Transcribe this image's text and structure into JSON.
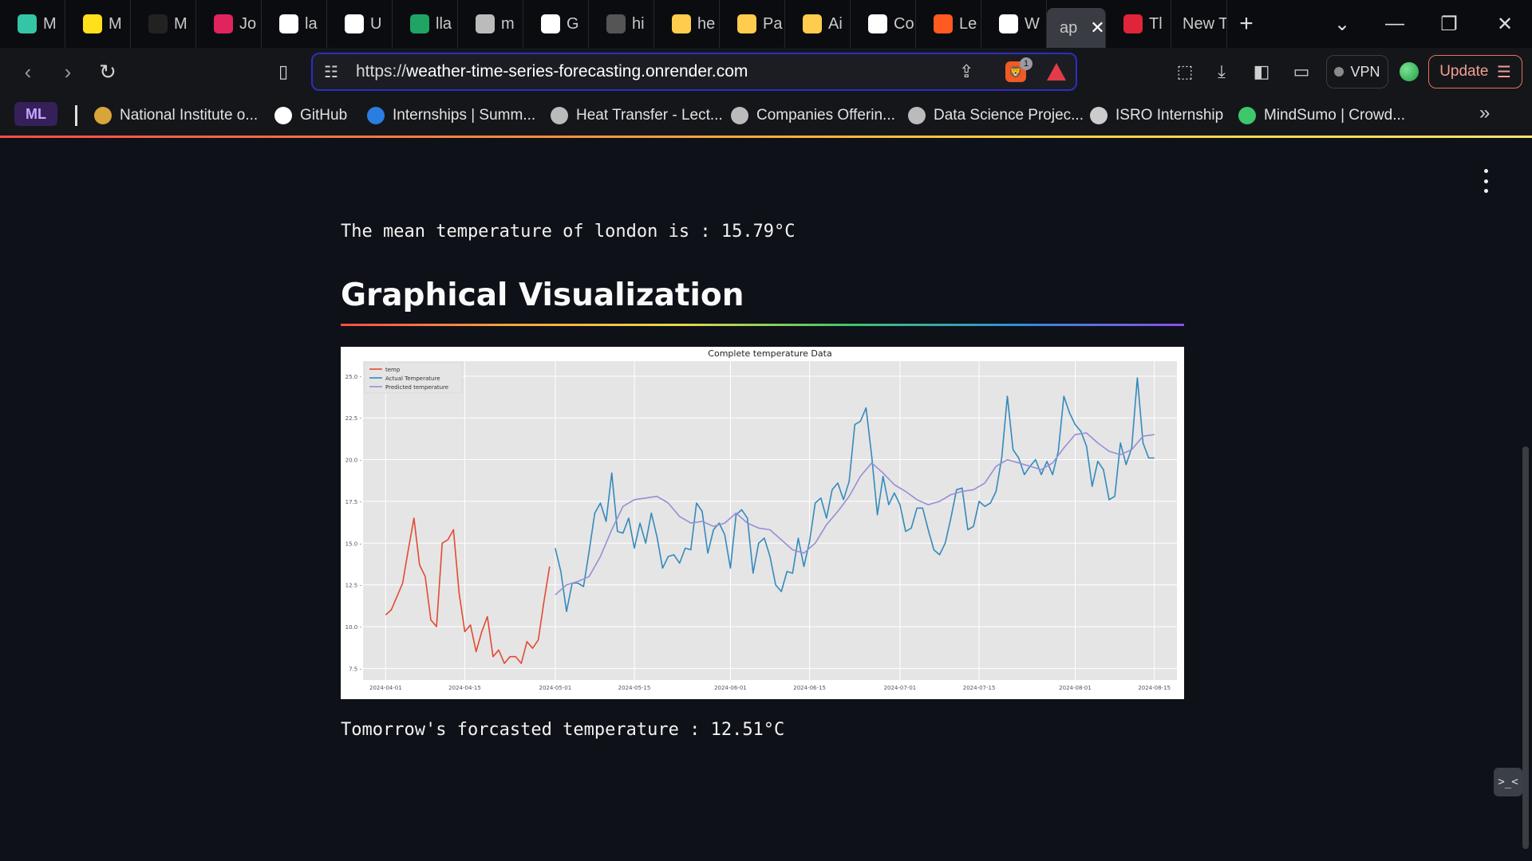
{
  "tabs": [
    {
      "label": "M",
      "icon": "wave-icon",
      "color": "#34c5a6"
    },
    {
      "label": "M",
      "icon": "mailchimp-icon",
      "color": "#ffe01b"
    },
    {
      "label": "M",
      "icon": "puzzle-icon",
      "color": "#222222"
    },
    {
      "label": "Jo",
      "icon": "s-logo-icon",
      "color": "#e0245e"
    },
    {
      "label": "la",
      "icon": "github-icon",
      "color": "#ffffff"
    },
    {
      "label": "U",
      "icon": "github-icon",
      "color": "#ffffff"
    },
    {
      "label": "lla",
      "icon": "drive-icon",
      "color": "#1fa463"
    },
    {
      "label": "m",
      "icon": "globe-icon",
      "color": "#bbbbbb"
    },
    {
      "label": "G",
      "icon": "openai-icon",
      "color": "#ffffff"
    },
    {
      "label": "hi",
      "icon": "github-icon",
      "color": "#555555"
    },
    {
      "label": "he",
      "icon": "huggingface-icon",
      "color": "#ffcc4d"
    },
    {
      "label": "Pa",
      "icon": "huggingface-icon",
      "color": "#ffcc4d"
    },
    {
      "label": "Ai",
      "icon": "huggingface-icon",
      "color": "#ffcc4d"
    },
    {
      "label": "Co",
      "icon": "d-logo-icon",
      "color": "#ffffff"
    },
    {
      "label": "Le",
      "icon": "orange-square-icon",
      "color": "#ff5a1f"
    },
    {
      "label": "W",
      "icon": "wrench-icon",
      "color": "#ffffff"
    },
    {
      "label": "ap",
      "icon": "",
      "color": "",
      "active": true
    },
    {
      "label": "Tl",
      "icon": "crown-icon",
      "color": "#e0243a"
    },
    {
      "label": "New T",
      "icon": "",
      "color": ""
    }
  ],
  "browser": {
    "url_prefix": "https://",
    "url_domain": "weather-time-series-forecasting.onrender.com",
    "vpn_label": "VPN",
    "update_label": "Update",
    "brave_badge": "1"
  },
  "bookmarks": [
    {
      "label": "National Institute o...",
      "icon": "nit-logo-icon",
      "color": "#d9a43a"
    },
    {
      "label": "GitHub",
      "icon": "github-icon",
      "color": "#ffffff"
    },
    {
      "label": "Internships | Summ...",
      "icon": "is-logo-icon",
      "color": "#2a7de1"
    },
    {
      "label": "Heat Transfer - Lect...",
      "icon": "globe-icon",
      "color": "#bbbbbb"
    },
    {
      "label": "Companies Offerin...",
      "icon": "t-circle-icon",
      "color": "#bbbbbb"
    },
    {
      "label": "Data Science Projec...",
      "icon": "t-circle-icon",
      "color": "#bbbbbb"
    },
    {
      "label": "ISRO Internship",
      "icon": "rocket-icon",
      "color": "#cccccc"
    },
    {
      "label": "MindSumo | Crowd...",
      "icon": "mindsumo-icon",
      "color": "#3ec76b"
    }
  ],
  "ml_chip": "ML",
  "content": {
    "mean_text": "The mean temperature of london is : 15.79°C",
    "heading": "Graphical Visualization",
    "forecast_text": "Tomorrow's forcasted temperature : 12.51°C"
  },
  "chart_data": {
    "type": "line",
    "title": "Complete temperature Data",
    "xlabel": "",
    "ylabel": "",
    "ylim": [
      6.8,
      25.9
    ],
    "xlim": [
      "2024-03-28",
      "2024-08-19"
    ],
    "grid": true,
    "legend_position": "top-left",
    "xticks": [
      "2024-04-01",
      "2024-04-15",
      "2024-05-01",
      "2024-05-15",
      "2024-06-01",
      "2024-06-15",
      "2024-07-01",
      "2024-07-15",
      "2024-08-01",
      "2024-08-15"
    ],
    "yticks": [
      7.5,
      10.0,
      12.5,
      15.0,
      17.5,
      20.0,
      22.5,
      25.0
    ],
    "series": [
      {
        "name": "temp",
        "color": "#e24a33",
        "x": [
          "2024-04-01",
          "2024-04-02",
          "2024-04-03",
          "2024-04-04",
          "2024-04-05",
          "2024-04-06",
          "2024-04-07",
          "2024-04-08",
          "2024-04-09",
          "2024-04-10",
          "2024-04-11",
          "2024-04-12",
          "2024-04-13",
          "2024-04-14",
          "2024-04-15",
          "2024-04-16",
          "2024-04-17",
          "2024-04-18",
          "2024-04-19",
          "2024-04-20",
          "2024-04-21",
          "2024-04-22",
          "2024-04-23",
          "2024-04-24",
          "2024-04-25",
          "2024-04-26",
          "2024-04-27",
          "2024-04-28",
          "2024-04-29",
          "2024-04-30"
        ],
        "values": [
          10.7,
          11.0,
          11.8,
          12.6,
          14.6,
          16.5,
          13.7,
          13.0,
          10.4,
          10.0,
          15.0,
          15.2,
          15.8,
          12.0,
          9.7,
          10.1,
          8.5,
          9.7,
          10.6,
          8.2,
          8.6,
          7.8,
          8.2,
          8.2,
          7.8,
          9.1,
          8.7,
          9.2,
          11.5,
          13.6
        ]
      },
      {
        "name": "Actual Temperature",
        "color": "#348abd",
        "x": [
          "2024-05-01",
          "2024-05-02",
          "2024-05-03",
          "2024-05-04",
          "2024-05-05",
          "2024-05-06",
          "2024-05-07",
          "2024-05-08",
          "2024-05-09",
          "2024-05-10",
          "2024-05-11",
          "2024-05-12",
          "2024-05-13",
          "2024-05-14",
          "2024-05-15",
          "2024-05-16",
          "2024-05-17",
          "2024-05-18",
          "2024-05-19",
          "2024-05-20",
          "2024-05-21",
          "2024-05-22",
          "2024-05-23",
          "2024-05-24",
          "2024-05-25",
          "2024-05-26",
          "2024-05-27",
          "2024-05-28",
          "2024-05-29",
          "2024-05-30",
          "2024-05-31",
          "2024-06-01",
          "2024-06-02",
          "2024-06-03",
          "2024-06-04",
          "2024-06-05",
          "2024-06-06",
          "2024-06-07",
          "2024-06-08",
          "2024-06-09",
          "2024-06-10",
          "2024-06-11",
          "2024-06-12",
          "2024-06-13",
          "2024-06-14",
          "2024-06-15",
          "2024-06-16",
          "2024-06-17",
          "2024-06-18",
          "2024-06-19",
          "2024-06-20",
          "2024-06-21",
          "2024-06-22",
          "2024-06-23",
          "2024-06-24",
          "2024-06-25",
          "2024-06-26",
          "2024-06-27",
          "2024-06-28",
          "2024-06-29",
          "2024-06-30",
          "2024-07-01",
          "2024-07-02",
          "2024-07-03",
          "2024-07-04",
          "2024-07-05",
          "2024-07-06",
          "2024-07-07",
          "2024-07-08",
          "2024-07-09",
          "2024-07-10",
          "2024-07-11",
          "2024-07-12",
          "2024-07-13",
          "2024-07-14",
          "2024-07-15",
          "2024-07-16",
          "2024-07-17",
          "2024-07-18",
          "2024-07-19",
          "2024-07-20",
          "2024-07-21",
          "2024-07-22",
          "2024-07-23",
          "2024-07-24",
          "2024-07-25",
          "2024-07-26",
          "2024-07-27",
          "2024-07-28",
          "2024-07-29",
          "2024-07-30",
          "2024-07-31",
          "2024-08-01",
          "2024-08-02",
          "2024-08-03",
          "2024-08-04",
          "2024-08-05",
          "2024-08-06",
          "2024-08-07",
          "2024-08-08",
          "2024-08-09",
          "2024-08-10",
          "2024-08-11",
          "2024-08-12",
          "2024-08-13",
          "2024-08-14",
          "2024-08-15"
        ],
        "values": [
          14.7,
          13.3,
          10.9,
          12.6,
          12.6,
          12.4,
          14.5,
          16.8,
          17.4,
          16.3,
          19.2,
          15.7,
          15.6,
          16.5,
          14.7,
          16.2,
          15.0,
          16.8,
          15.4,
          13.5,
          14.2,
          14.3,
          13.8,
          14.7,
          14.6,
          17.4,
          16.9,
          14.4,
          15.8,
          16.2,
          15.5,
          13.5,
          16.7,
          17.0,
          16.5,
          13.2,
          15.0,
          15.3,
          14.2,
          12.5,
          12.1,
          13.3,
          13.2,
          15.3,
          13.6,
          15.1,
          17.4,
          17.7,
          16.5,
          18.2,
          18.6,
          17.6,
          18.7,
          22.1,
          22.3,
          23.1,
          20.2,
          16.7,
          19.0,
          17.3,
          18.0,
          17.3,
          15.7,
          15.9,
          17.1,
          17.1,
          15.8,
          14.6,
          14.3,
          15.0,
          16.5,
          18.2,
          18.3,
          15.8,
          16.0,
          17.5,
          17.2,
          17.4,
          18.1,
          20.1,
          23.8,
          20.6,
          20.1,
          19.1,
          19.6,
          20.0,
          19.1,
          19.9,
          19.1,
          20.5,
          23.8,
          22.8,
          22.1,
          21.7,
          20.8,
          18.4,
          19.9,
          19.4,
          17.6,
          17.8,
          21.0,
          19.7,
          20.7,
          24.9,
          21.0,
          20.1,
          20.1
        ]
      },
      {
        "name": "Predicted temperature",
        "color": "#988ed5",
        "x": [
          "2024-05-01",
          "2024-05-03",
          "2024-05-05",
          "2024-05-07",
          "2024-05-09",
          "2024-05-11",
          "2024-05-13",
          "2024-05-15",
          "2024-05-17",
          "2024-05-19",
          "2024-05-21",
          "2024-05-23",
          "2024-05-25",
          "2024-05-27",
          "2024-05-29",
          "2024-05-31",
          "2024-06-02",
          "2024-06-04",
          "2024-06-06",
          "2024-06-08",
          "2024-06-10",
          "2024-06-12",
          "2024-06-14",
          "2024-06-16",
          "2024-06-18",
          "2024-06-20",
          "2024-06-22",
          "2024-06-24",
          "2024-06-26",
          "2024-06-28",
          "2024-06-30",
          "2024-07-02",
          "2024-07-04",
          "2024-07-06",
          "2024-07-08",
          "2024-07-10",
          "2024-07-12",
          "2024-07-14",
          "2024-07-16",
          "2024-07-18",
          "2024-07-20",
          "2024-07-22",
          "2024-07-24",
          "2024-07-26",
          "2024-07-28",
          "2024-07-30",
          "2024-08-01",
          "2024-08-03",
          "2024-08-05",
          "2024-08-07",
          "2024-08-09",
          "2024-08-11",
          "2024-08-13",
          "2024-08-15"
        ],
        "values": [
          11.9,
          12.5,
          12.7,
          13.0,
          14.2,
          15.8,
          17.2,
          17.6,
          17.7,
          17.8,
          17.4,
          16.6,
          16.2,
          16.3,
          16.0,
          16.2,
          16.8,
          16.2,
          15.9,
          15.8,
          15.2,
          14.6,
          14.4,
          15.0,
          16.1,
          16.9,
          17.8,
          19.0,
          19.8,
          19.2,
          18.5,
          18.1,
          17.6,
          17.3,
          17.5,
          17.9,
          18.1,
          18.2,
          18.6,
          19.6,
          20.0,
          19.8,
          19.6,
          19.4,
          19.8,
          20.7,
          21.5,
          21.6,
          21.0,
          20.5,
          20.3,
          20.6,
          21.4,
          21.5
        ]
      }
    ]
  }
}
